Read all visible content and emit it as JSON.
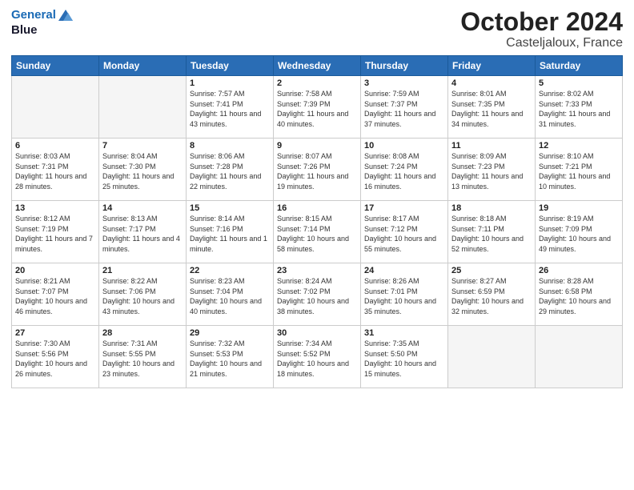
{
  "header": {
    "logo_line1": "General",
    "logo_line2": "Blue",
    "month": "October 2024",
    "location": "Casteljaloux, France"
  },
  "weekdays": [
    "Sunday",
    "Monday",
    "Tuesday",
    "Wednesday",
    "Thursday",
    "Friday",
    "Saturday"
  ],
  "weeks": [
    [
      {
        "day": "",
        "empty": true
      },
      {
        "day": "",
        "empty": true
      },
      {
        "day": "1",
        "sunrise": "Sunrise: 7:57 AM",
        "sunset": "Sunset: 7:41 PM",
        "daylight": "Daylight: 11 hours and 43 minutes."
      },
      {
        "day": "2",
        "sunrise": "Sunrise: 7:58 AM",
        "sunset": "Sunset: 7:39 PM",
        "daylight": "Daylight: 11 hours and 40 minutes."
      },
      {
        "day": "3",
        "sunrise": "Sunrise: 7:59 AM",
        "sunset": "Sunset: 7:37 PM",
        "daylight": "Daylight: 11 hours and 37 minutes."
      },
      {
        "day": "4",
        "sunrise": "Sunrise: 8:01 AM",
        "sunset": "Sunset: 7:35 PM",
        "daylight": "Daylight: 11 hours and 34 minutes."
      },
      {
        "day": "5",
        "sunrise": "Sunrise: 8:02 AM",
        "sunset": "Sunset: 7:33 PM",
        "daylight": "Daylight: 11 hours and 31 minutes."
      }
    ],
    [
      {
        "day": "6",
        "sunrise": "Sunrise: 8:03 AM",
        "sunset": "Sunset: 7:31 PM",
        "daylight": "Daylight: 11 hours and 28 minutes."
      },
      {
        "day": "7",
        "sunrise": "Sunrise: 8:04 AM",
        "sunset": "Sunset: 7:30 PM",
        "daylight": "Daylight: 11 hours and 25 minutes."
      },
      {
        "day": "8",
        "sunrise": "Sunrise: 8:06 AM",
        "sunset": "Sunset: 7:28 PM",
        "daylight": "Daylight: 11 hours and 22 minutes."
      },
      {
        "day": "9",
        "sunrise": "Sunrise: 8:07 AM",
        "sunset": "Sunset: 7:26 PM",
        "daylight": "Daylight: 11 hours and 19 minutes."
      },
      {
        "day": "10",
        "sunrise": "Sunrise: 8:08 AM",
        "sunset": "Sunset: 7:24 PM",
        "daylight": "Daylight: 11 hours and 16 minutes."
      },
      {
        "day": "11",
        "sunrise": "Sunrise: 8:09 AM",
        "sunset": "Sunset: 7:23 PM",
        "daylight": "Daylight: 11 hours and 13 minutes."
      },
      {
        "day": "12",
        "sunrise": "Sunrise: 8:10 AM",
        "sunset": "Sunset: 7:21 PM",
        "daylight": "Daylight: 11 hours and 10 minutes."
      }
    ],
    [
      {
        "day": "13",
        "sunrise": "Sunrise: 8:12 AM",
        "sunset": "Sunset: 7:19 PM",
        "daylight": "Daylight: 11 hours and 7 minutes."
      },
      {
        "day": "14",
        "sunrise": "Sunrise: 8:13 AM",
        "sunset": "Sunset: 7:17 PM",
        "daylight": "Daylight: 11 hours and 4 minutes."
      },
      {
        "day": "15",
        "sunrise": "Sunrise: 8:14 AM",
        "sunset": "Sunset: 7:16 PM",
        "daylight": "Daylight: 11 hours and 1 minute."
      },
      {
        "day": "16",
        "sunrise": "Sunrise: 8:15 AM",
        "sunset": "Sunset: 7:14 PM",
        "daylight": "Daylight: 10 hours and 58 minutes."
      },
      {
        "day": "17",
        "sunrise": "Sunrise: 8:17 AM",
        "sunset": "Sunset: 7:12 PM",
        "daylight": "Daylight: 10 hours and 55 minutes."
      },
      {
        "day": "18",
        "sunrise": "Sunrise: 8:18 AM",
        "sunset": "Sunset: 7:11 PM",
        "daylight": "Daylight: 10 hours and 52 minutes."
      },
      {
        "day": "19",
        "sunrise": "Sunrise: 8:19 AM",
        "sunset": "Sunset: 7:09 PM",
        "daylight": "Daylight: 10 hours and 49 minutes."
      }
    ],
    [
      {
        "day": "20",
        "sunrise": "Sunrise: 8:21 AM",
        "sunset": "Sunset: 7:07 PM",
        "daylight": "Daylight: 10 hours and 46 minutes."
      },
      {
        "day": "21",
        "sunrise": "Sunrise: 8:22 AM",
        "sunset": "Sunset: 7:06 PM",
        "daylight": "Daylight: 10 hours and 43 minutes."
      },
      {
        "day": "22",
        "sunrise": "Sunrise: 8:23 AM",
        "sunset": "Sunset: 7:04 PM",
        "daylight": "Daylight: 10 hours and 40 minutes."
      },
      {
        "day": "23",
        "sunrise": "Sunrise: 8:24 AM",
        "sunset": "Sunset: 7:02 PM",
        "daylight": "Daylight: 10 hours and 38 minutes."
      },
      {
        "day": "24",
        "sunrise": "Sunrise: 8:26 AM",
        "sunset": "Sunset: 7:01 PM",
        "daylight": "Daylight: 10 hours and 35 minutes."
      },
      {
        "day": "25",
        "sunrise": "Sunrise: 8:27 AM",
        "sunset": "Sunset: 6:59 PM",
        "daylight": "Daylight: 10 hours and 32 minutes."
      },
      {
        "day": "26",
        "sunrise": "Sunrise: 8:28 AM",
        "sunset": "Sunset: 6:58 PM",
        "daylight": "Daylight: 10 hours and 29 minutes."
      }
    ],
    [
      {
        "day": "27",
        "sunrise": "Sunrise: 7:30 AM",
        "sunset": "Sunset: 5:56 PM",
        "daylight": "Daylight: 10 hours and 26 minutes."
      },
      {
        "day": "28",
        "sunrise": "Sunrise: 7:31 AM",
        "sunset": "Sunset: 5:55 PM",
        "daylight": "Daylight: 10 hours and 23 minutes."
      },
      {
        "day": "29",
        "sunrise": "Sunrise: 7:32 AM",
        "sunset": "Sunset: 5:53 PM",
        "daylight": "Daylight: 10 hours and 21 minutes."
      },
      {
        "day": "30",
        "sunrise": "Sunrise: 7:34 AM",
        "sunset": "Sunset: 5:52 PM",
        "daylight": "Daylight: 10 hours and 18 minutes."
      },
      {
        "day": "31",
        "sunrise": "Sunrise: 7:35 AM",
        "sunset": "Sunset: 5:50 PM",
        "daylight": "Daylight: 10 hours and 15 minutes."
      },
      {
        "day": "",
        "empty": true
      },
      {
        "day": "",
        "empty": true
      }
    ]
  ]
}
